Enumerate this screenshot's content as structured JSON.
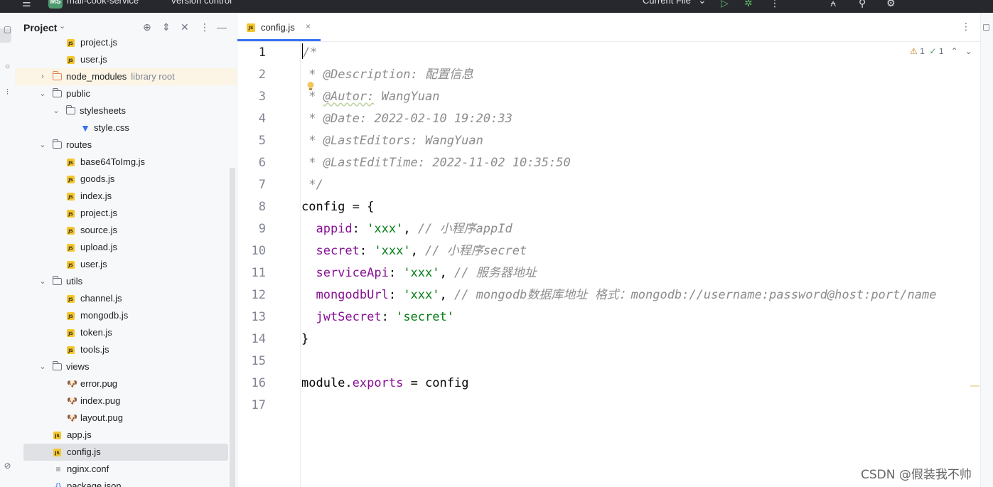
{
  "titlebar": {
    "project_badge": "MS",
    "project_name": "mall-cook-service",
    "vcs": "Version control",
    "run_config": "Current File",
    "chevron": "⌄",
    "menu_glyph": "☰",
    "run_glyph": "▷",
    "debug_glyph": "✲",
    "more_glyph": "⋮",
    "add_user_glyph": "⍲",
    "search_glyph": "⚲",
    "settings_glyph": "⚙"
  },
  "project_panel": {
    "title": "Project",
    "title_chevron": "⌄",
    "locate_glyph": "⊕",
    "expand_glyph": "⇕",
    "collapse_glyph": "✕",
    "options_glyph": "⋮",
    "hide_glyph": "—",
    "tree": [
      {
        "name": "project.js",
        "type": "js",
        "depth": 3
      },
      {
        "name": "user.js",
        "type": "js",
        "depth": 3
      },
      {
        "name": "node_modules",
        "hint": "library root",
        "type": "folder-orange",
        "depth": 1,
        "arrow": "›"
      },
      {
        "name": "public",
        "type": "folder",
        "depth": 1,
        "arrow": "⌄"
      },
      {
        "name": "stylesheets",
        "type": "folder",
        "depth": 2,
        "arrow": "⌄"
      },
      {
        "name": "style.css",
        "type": "css",
        "depth": 4
      },
      {
        "name": "routes",
        "type": "folder",
        "depth": 1,
        "arrow": "⌄"
      },
      {
        "name": "base64ToImg.js",
        "type": "js",
        "depth": 3
      },
      {
        "name": "goods.js",
        "type": "js",
        "depth": 3
      },
      {
        "name": "index.js",
        "type": "js",
        "depth": 3
      },
      {
        "name": "project.js",
        "type": "js",
        "depth": 3
      },
      {
        "name": "source.js",
        "type": "js",
        "depth": 3
      },
      {
        "name": "upload.js",
        "type": "js",
        "depth": 3
      },
      {
        "name": "user.js",
        "type": "js",
        "depth": 3
      },
      {
        "name": "utils",
        "type": "folder",
        "depth": 1,
        "arrow": "⌄"
      },
      {
        "name": "channel.js",
        "type": "js",
        "depth": 3
      },
      {
        "name": "mongodb.js",
        "type": "js",
        "depth": 3
      },
      {
        "name": "token.js",
        "type": "js",
        "depth": 3
      },
      {
        "name": "tools.js",
        "type": "js",
        "depth": 3
      },
      {
        "name": "views",
        "type": "folder",
        "depth": 1,
        "arrow": "⌄"
      },
      {
        "name": "error.pug",
        "type": "pug",
        "depth": 3
      },
      {
        "name": "index.pug",
        "type": "pug",
        "depth": 3
      },
      {
        "name": "layout.pug",
        "type": "pug",
        "depth": 3
      },
      {
        "name": "app.js",
        "type": "js",
        "depth": 2
      },
      {
        "name": "config.js",
        "type": "js",
        "depth": 2
      },
      {
        "name": "nginx.conf",
        "type": "text",
        "depth": 2
      },
      {
        "name": "package.json",
        "type": "json",
        "depth": 2
      }
    ],
    "icon_glyphs": {
      "js": "JS",
      "css": "▼",
      "pug": "🐶",
      "text": "≡",
      "json": "{}"
    }
  },
  "editor": {
    "tab_label": "config.js",
    "tab_icon": "JS",
    "tab_close": "×",
    "tab_menu": "⋮",
    "inspections": {
      "warnings": "1",
      "ok": "1",
      "warn_glyph": "⚠",
      "ok_glyph": "✓",
      "up": "⌃",
      "down": "⌄"
    },
    "line_numbers": [
      "1",
      "2",
      "3",
      "4",
      "5",
      "6",
      "7",
      "8",
      "9",
      "10",
      "11",
      "12",
      "13",
      "14",
      "15",
      "16",
      "17"
    ],
    "code": {
      "l1": "/*",
      "l2_star": " * ",
      "l2_tag": "@Description:",
      "l2_val": " 配置信息",
      "l3_star": " * ",
      "l3_tag": "@Autor:",
      "l3_val": " WangYuan",
      "l4": " * @Date: 2022-02-10 19:20:33",
      "l5": " * @LastEditors: WangYuan",
      "l6": " * @LastEditTime: 2022-11-02 10:35:50",
      "l7": " */",
      "l8": "config = {",
      "l9_key": "  appid",
      "l9_sep": ": ",
      "l9_str": "'xxx'",
      "l9_comma": ", ",
      "l9_cmt": "// 小程序appId",
      "l10_key": "  secret",
      "l10_sep": ": ",
      "l10_str": "'xxx'",
      "l10_comma": ", ",
      "l10_cmt": "// 小程序secret",
      "l11_key": "  serviceApi",
      "l11_sep": ": ",
      "l11_str": "'xxx'",
      "l11_comma": ", ",
      "l11_cmt": "// 服务器地址",
      "l12_key": "  mongodbUrl",
      "l12_sep": ": ",
      "l12_str": "'xxx'",
      "l12_comma": ", ",
      "l12_cmt": "// mongodb数据库地址 格式：mongodb://username:password@host:port/name",
      "l13_key": "  jwtSecret",
      "l13_sep": ": ",
      "l13_str": "'secret'",
      "l14": "}",
      "l16_obj": "module",
      "l16_dot": ".",
      "l16_prop": "exports",
      "l16_rest": " = config"
    }
  },
  "watermark": "CSDN @假装我不帅",
  "colors": {
    "accent": "#3574f0",
    "js_badge": "#f5c62c",
    "comment": "#8c8c8c",
    "string": "#067d17",
    "property": "#871094"
  }
}
